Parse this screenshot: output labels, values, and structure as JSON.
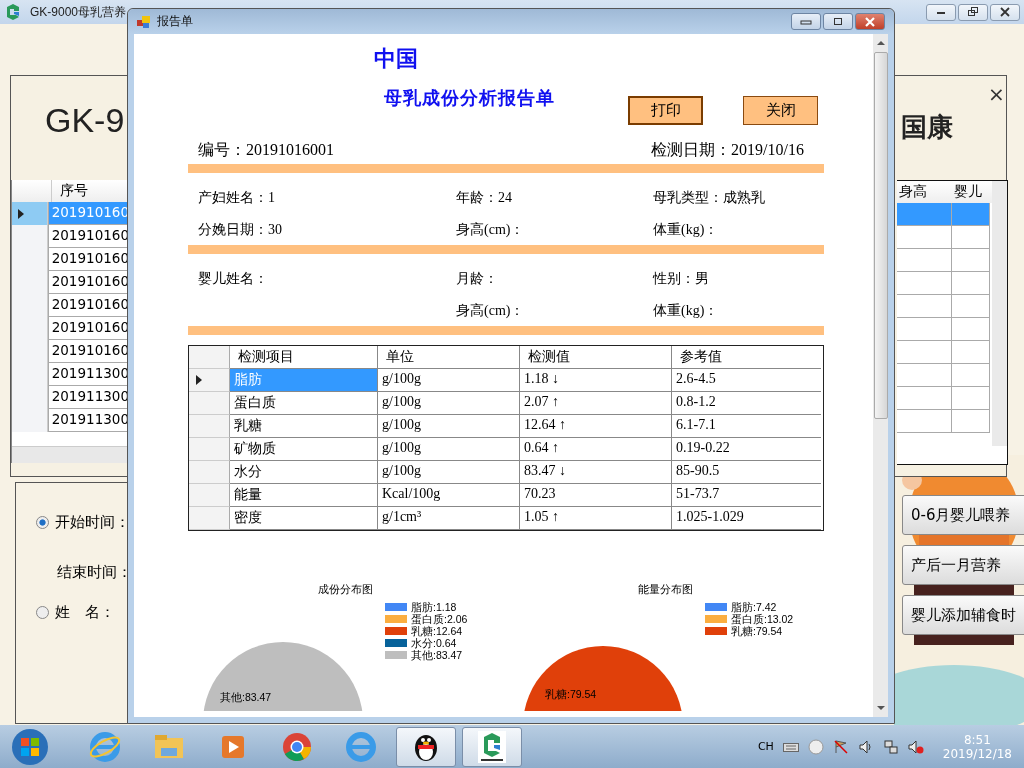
{
  "app_window": {
    "title": "GK-9000母乳营养",
    "panel_title_left": "GK-9",
    "panel_title_right": "国康",
    "panel_close": "×",
    "records_table": {
      "columns": [
        "序号",
        "身高",
        "婴儿"
      ],
      "rows": [
        {
          "id": "201910160",
          "selected": true
        },
        {
          "id": "201910160",
          "selected": false
        },
        {
          "id": "201910160",
          "selected": false
        },
        {
          "id": "201910160",
          "selected": false
        },
        {
          "id": "201910160",
          "selected": false
        },
        {
          "id": "201910160",
          "selected": false
        },
        {
          "id": "201910160",
          "selected": false
        },
        {
          "id": "201911300",
          "selected": false
        },
        {
          "id": "201911300",
          "selected": false
        },
        {
          "id": "201911300",
          "selected": false
        }
      ]
    },
    "search_panel": {
      "options": [
        {
          "label": "开始时间：",
          "selected": true
        },
        {
          "label": "姓　名：",
          "selected": false
        }
      ],
      "end_time_label": "结束时间："
    },
    "guide_buttons": [
      "0-6月婴儿喂养",
      "产后一月营养",
      "婴儿添加辅食时"
    ]
  },
  "dialog": {
    "title": "报告单",
    "org": "中国",
    "heading": "母乳成份分析报告单",
    "buttons": [
      {
        "label": "打印",
        "focused": true
      },
      {
        "label": "关闭",
        "focused": false
      }
    ],
    "report_no": "编号：20191016001",
    "test_date": "检测日期：2019/10/16",
    "mother": [
      "产妇姓名：1",
      "年龄：24",
      "母乳类型：成熟乳",
      "分娩日期：30",
      "身高(cm)：",
      "体重(kg)："
    ],
    "infant": [
      [
        "婴儿姓名：",
        "月龄：",
        "性别：男"
      ],
      [
        "身高(cm)：",
        "体重(kg)："
      ]
    ],
    "results": {
      "columns": [
        "检测项目",
        "单位",
        "检测值",
        "参考值"
      ],
      "rows": [
        {
          "item": "脂肪",
          "unit": "g/100g",
          "value": "1.18 ↓",
          "reference": "2.6-4.5",
          "selected": true
        },
        {
          "item": "蛋白质",
          "unit": "g/100g",
          "value": "2.07 ↑",
          "reference": "0.8-1.2",
          "selected": false
        },
        {
          "item": "乳糖",
          "unit": "g/100g",
          "value": "12.64 ↑",
          "reference": "6.1-7.1",
          "selected": false
        },
        {
          "item": "矿物质",
          "unit": "g/100g",
          "value": "0.64 ↑",
          "reference": "0.19-0.22",
          "selected": false
        },
        {
          "item": "水分",
          "unit": "g/100g",
          "value": "83.47 ↓",
          "reference": "85-90.5",
          "selected": false
        },
        {
          "item": "能量",
          "unit": "Kcal/100g",
          "value": "70.23",
          "reference": "51-73.7",
          "selected": false
        },
        {
          "item": "密度",
          "unit": "g/1cm³",
          "value": "1.05 ↑",
          "reference": "1.025-1.029",
          "selected": false
        }
      ]
    },
    "charts": [
      {
        "title": "成份分布图",
        "legend": [
          {
            "label": "脂肪:1.18",
            "color": "#4287f5"
          },
          {
            "label": "蛋白质:2.06",
            "color": "#fbae40"
          },
          {
            "label": "乳糖:12.64",
            "color": "#e0400a"
          },
          {
            "label": "水分:0.64",
            "color": "#07629a"
          },
          {
            "label": "其他:83.47",
            "color": "#bebebe"
          }
        ],
        "slice_label": "其他:83.47"
      },
      {
        "title": "能量分布图",
        "legend": [
          {
            "label": "脂肪:7.42",
            "color": "#4287f5"
          },
          {
            "label": "蛋白质:13.02",
            "color": "#fbae40"
          },
          {
            "label": "乳糖:79.54",
            "color": "#e0400a"
          }
        ],
        "slice_label": "乳糖:79.54"
      }
    ]
  },
  "taskbar": {
    "input_language": "CH",
    "time": "8:51",
    "date": "2019/12/18"
  }
}
